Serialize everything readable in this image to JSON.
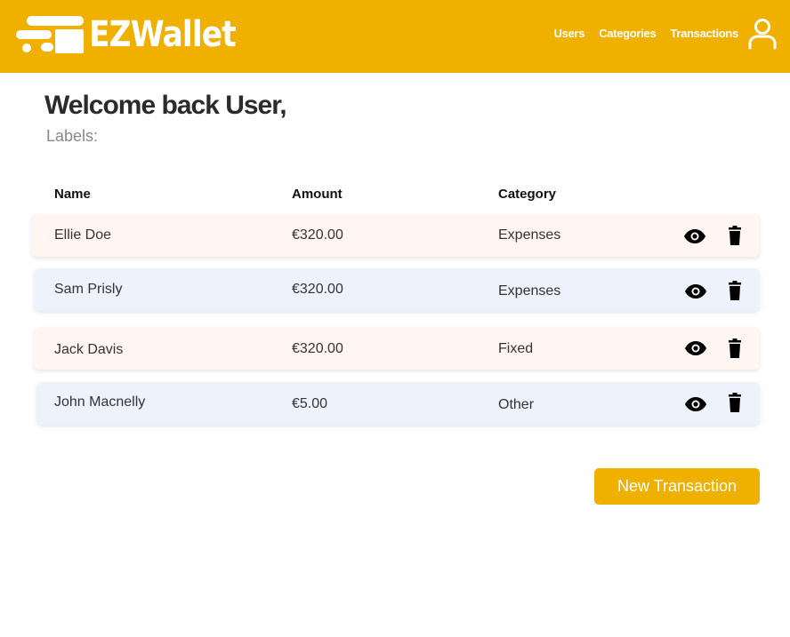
{
  "header": {
    "brand": "EZWallet",
    "nav": [
      {
        "label": "Users"
      },
      {
        "label": "Categories"
      },
      {
        "label": "Transactions"
      }
    ]
  },
  "main": {
    "welcome": "Welcome back User,",
    "labels": "Labels:"
  },
  "table": {
    "columns": [
      "Name",
      "Amount",
      "Category"
    ],
    "rows": [
      {
        "name": "Ellie Doe",
        "amount": "€320.00",
        "category": "Expenses"
      },
      {
        "name": "Sam Prisly",
        "amount": "€320.00",
        "category": "Expenses"
      },
      {
        "name": "Jack Davis",
        "amount": "€320.00",
        "category": "Fixed"
      },
      {
        "name": "John Macnelly",
        "amount": "€5.00",
        "category": "Other"
      }
    ]
  },
  "actions": {
    "new_transaction": "New Transaction"
  },
  "colors": {
    "brand": "#f0b000",
    "row_odd": "#fff6f2",
    "row_even": "#eef2fd"
  },
  "icons": [
    "logo-speed-icon",
    "user-icon",
    "eye-icon",
    "trash-icon"
  ]
}
